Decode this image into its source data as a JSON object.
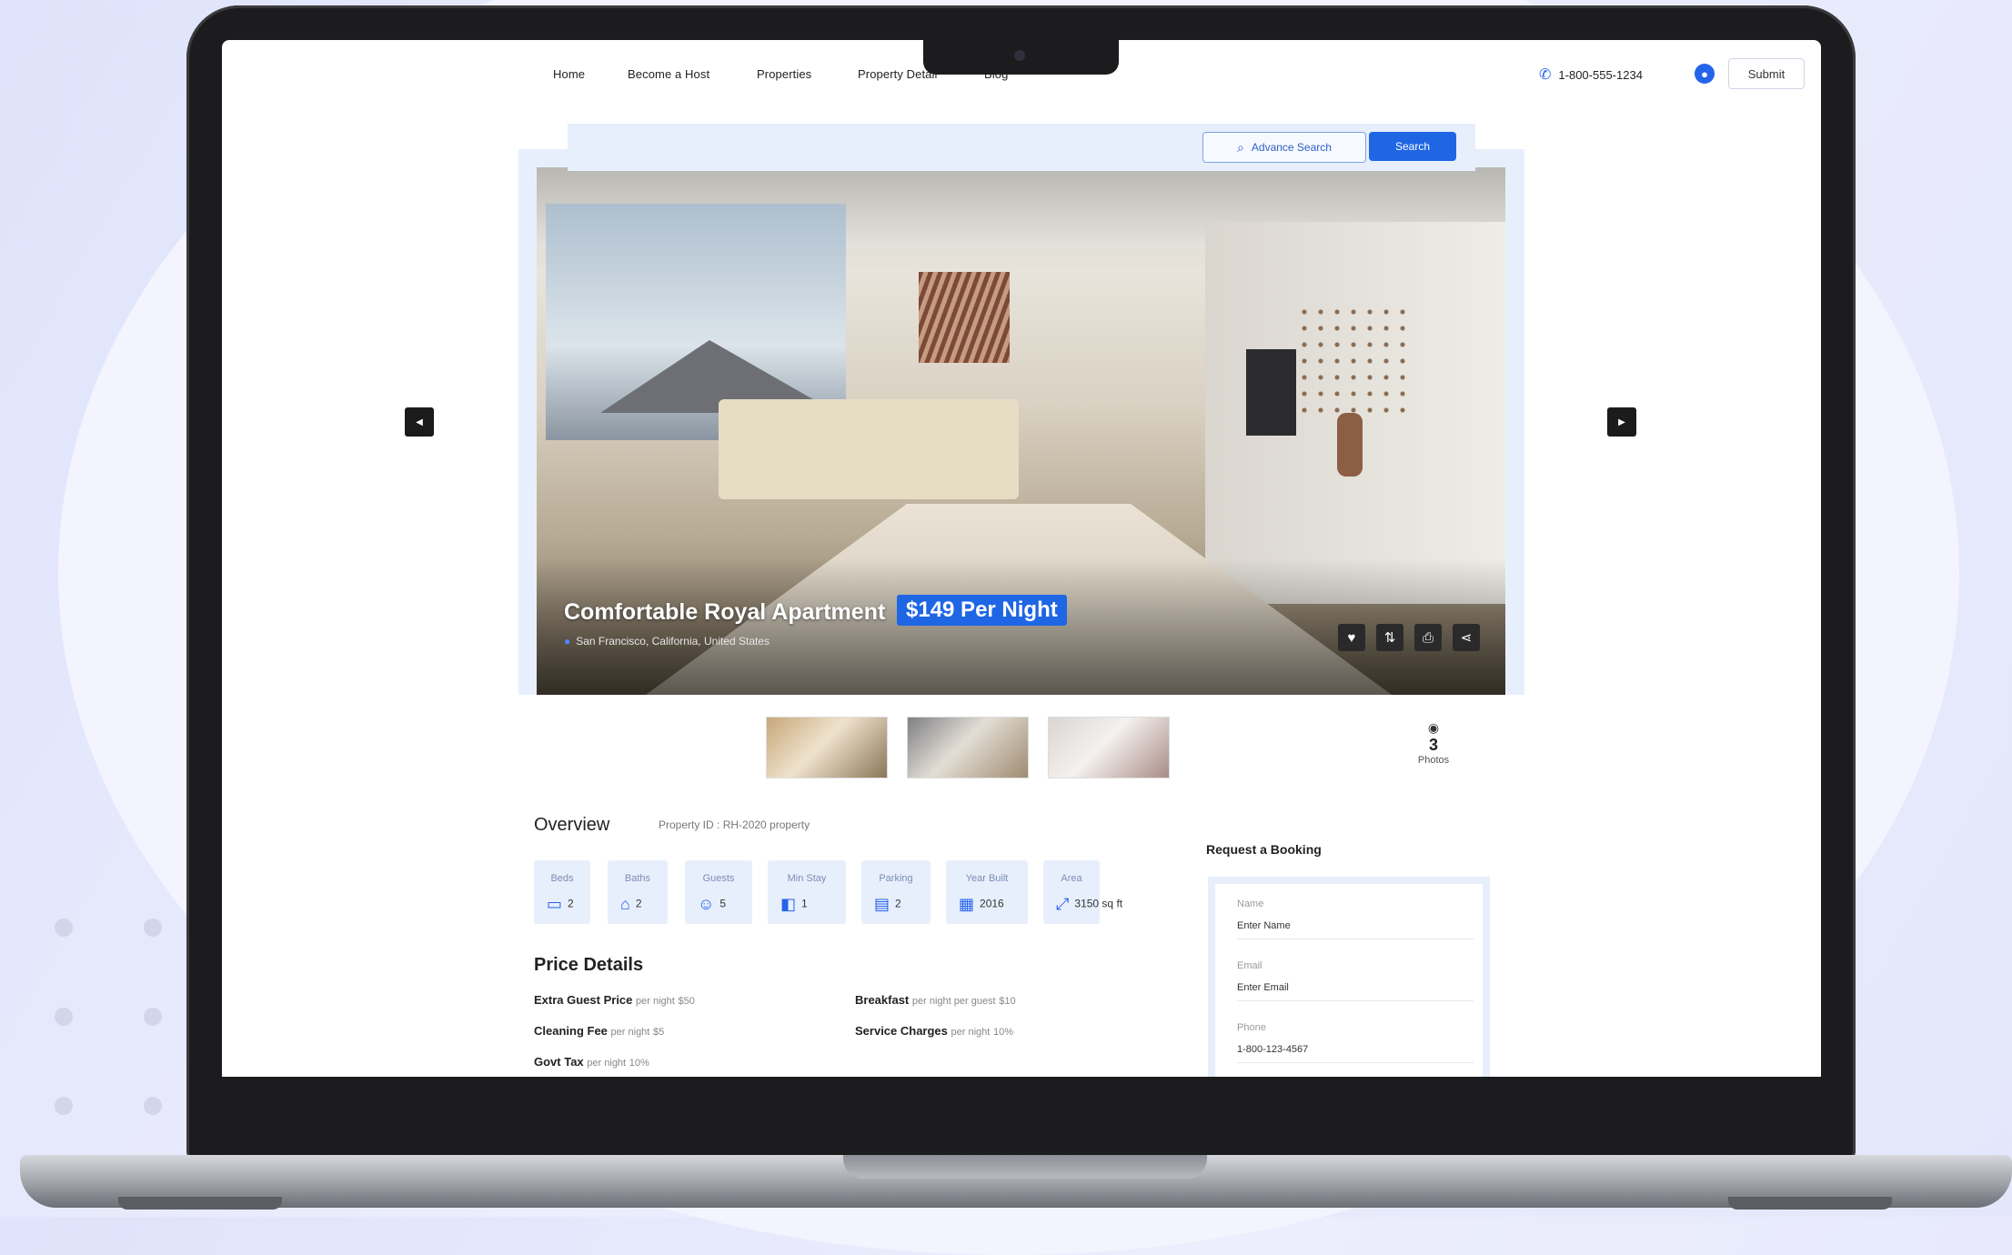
{
  "nav": {
    "links": [
      "Home",
      "Become a Host",
      "Properties",
      "Property Detail",
      "Blog"
    ],
    "phone": "1-800-555-1234",
    "submit_label": "Submit"
  },
  "search": {
    "advance_label": "Advance Search",
    "search_label": "Search"
  },
  "listing": {
    "title": "Comfortable Royal Apartment",
    "price": "$149 Per Night",
    "location": "San Francisco, California, United States",
    "photo_count": "3",
    "photo_label": "Photos"
  },
  "overview": {
    "title": "Overview",
    "property_id": "Property ID : RH-2020 property",
    "features": [
      {
        "label": "Beds",
        "value": "2",
        "icon": "bed-icon"
      },
      {
        "label": "Baths",
        "value": "2",
        "icon": "bath-icon"
      },
      {
        "label": "Guests",
        "value": "5",
        "icon": "guests-icon"
      },
      {
        "label": "Min Stay",
        "value": "1",
        "icon": "stay-icon"
      },
      {
        "label": "Parking",
        "value": "2",
        "icon": "parking-icon"
      },
      {
        "label": "Year Built",
        "value": "2016",
        "icon": "calendar-icon"
      },
      {
        "label": "Area",
        "value": "3150 sq ft",
        "icon": "area-icon"
      }
    ]
  },
  "price_details": {
    "title": "Price Details",
    "rows": [
      {
        "label": "Extra Guest Price",
        "note": "per night",
        "value": "$50"
      },
      {
        "label": "Breakfast",
        "note": "per night per guest",
        "value": "$10"
      },
      {
        "label": "Cleaning Fee",
        "note": "per night",
        "value": "$5"
      },
      {
        "label": "Service Charges",
        "note": "per night",
        "value": "10%"
      },
      {
        "label": "Govt Tax",
        "note": "per night",
        "value": "10%"
      }
    ]
  },
  "booking": {
    "title": "Request a Booking",
    "fields": [
      {
        "label": "Name",
        "value": "Enter Name"
      },
      {
        "label": "Email",
        "value": "Enter Email"
      },
      {
        "label": "Phone",
        "value": "1-800-123-4567"
      }
    ]
  },
  "colors": {
    "accent": "#1f66e5",
    "panel": "#e8effc"
  }
}
